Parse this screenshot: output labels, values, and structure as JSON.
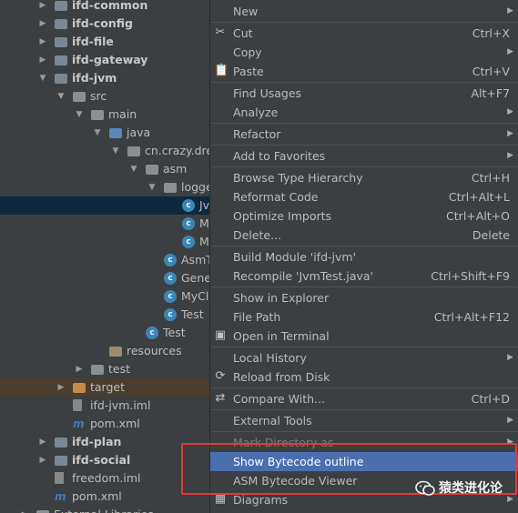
{
  "tree": {
    "items": [
      {
        "label": "ifd-common",
        "bold": true,
        "arrow": "▶",
        "kind": "folder-mod"
      },
      {
        "label": "ifd-config",
        "bold": true,
        "arrow": "▶",
        "kind": "folder-mod"
      },
      {
        "label": "ifd-file",
        "bold": true,
        "arrow": "▶",
        "kind": "folder-mod"
      },
      {
        "label": "ifd-gateway",
        "bold": true,
        "arrow": "▶",
        "kind": "folder-mod"
      },
      {
        "label": "ifd-jvm",
        "bold": true,
        "arrow": "▼",
        "kind": "folder-mod"
      },
      {
        "label": "src",
        "arrow": "▼",
        "kind": "folder"
      },
      {
        "label": "main",
        "arrow": "▼",
        "kind": "folder"
      },
      {
        "label": "java",
        "arrow": "▼",
        "kind": "folder-src"
      },
      {
        "label": "cn.crazy.dreamer",
        "arrow": "▼",
        "kind": "folder-pkg"
      },
      {
        "label": "asm",
        "arrow": "▼",
        "kind": "folder-pkg"
      },
      {
        "label": "logger",
        "arrow": "▼",
        "kind": "folder-pkg"
      },
      {
        "label": "JvmTest",
        "kind": "class",
        "selected": true
      },
      {
        "label": "MyLogg",
        "kind": "class"
      },
      {
        "label": "MyTime",
        "kind": "class"
      },
      {
        "label": "AsmTest",
        "kind": "class"
      },
      {
        "label": "Generator",
        "kind": "class"
      },
      {
        "label": "MyClassVis",
        "kind": "class"
      },
      {
        "label": "Test",
        "kind": "class"
      },
      {
        "label": "Test",
        "kind": "class"
      },
      {
        "label": "resources",
        "kind": "folder-res"
      },
      {
        "label": "test",
        "arrow": "▶",
        "kind": "folder"
      },
      {
        "label": "target",
        "arrow": "▶",
        "kind": "folder-excl",
        "excluded": true
      },
      {
        "label": "ifd-jvm.iml",
        "kind": "iml"
      },
      {
        "label": "pom.xml",
        "kind": "maven"
      },
      {
        "label": "ifd-plan",
        "bold": true,
        "arrow": "▶",
        "kind": "folder-mod"
      },
      {
        "label": "ifd-social",
        "bold": true,
        "arrow": "▶",
        "kind": "folder-mod"
      },
      {
        "label": "freedom.iml",
        "kind": "iml"
      },
      {
        "label": "pom.xml",
        "kind": "maven"
      },
      {
        "label": "External Libraries",
        "arrow": "▶",
        "kind": "folder"
      }
    ]
  },
  "menu": {
    "items": [
      {
        "label": "New",
        "submenu": true,
        "name": "menu-new"
      },
      {
        "sep": true
      },
      {
        "label": "Cut",
        "shortcut": "Ctrl+X",
        "icon": "scissors-icon",
        "glyph": "✂",
        "name": "menu-cut"
      },
      {
        "label": "Copy",
        "submenu": true,
        "name": "menu-copy"
      },
      {
        "label": "Paste",
        "shortcut": "Ctrl+V",
        "icon": "clipboard-icon",
        "glyph": "📋",
        "name": "menu-paste"
      },
      {
        "sep": true
      },
      {
        "label": "Find Usages",
        "shortcut": "Alt+F7",
        "name": "menu-find-usages"
      },
      {
        "label": "Analyze",
        "submenu": true,
        "name": "menu-analyze"
      },
      {
        "sep": true
      },
      {
        "label": "Refactor",
        "submenu": true,
        "name": "menu-refactor"
      },
      {
        "sep": true
      },
      {
        "label": "Add to Favorites",
        "submenu": true,
        "name": "menu-add-to-favorites"
      },
      {
        "sep": true
      },
      {
        "label": "Browse Type Hierarchy",
        "shortcut": "Ctrl+H",
        "name": "menu-browse-type-hierarchy"
      },
      {
        "label": "Reformat Code",
        "shortcut": "Ctrl+Alt+L",
        "name": "menu-reformat-code"
      },
      {
        "label": "Optimize Imports",
        "shortcut": "Ctrl+Alt+O",
        "name": "menu-optimize-imports"
      },
      {
        "label": "Delete...",
        "shortcut": "Delete",
        "name": "menu-delete"
      },
      {
        "sep": true
      },
      {
        "label": "Build Module 'ifd-jvm'",
        "name": "menu-build-module"
      },
      {
        "label": "Recompile 'JvmTest.java'",
        "shortcut": "Ctrl+Shift+F9",
        "name": "menu-recompile"
      },
      {
        "sep": true
      },
      {
        "label": "Show in Explorer",
        "name": "menu-show-in-explorer"
      },
      {
        "label": "File Path",
        "shortcut": "Ctrl+Alt+F12",
        "name": "menu-file-path"
      },
      {
        "label": "Open in Terminal",
        "icon": "terminal-icon",
        "glyph": "▣",
        "name": "menu-open-in-terminal"
      },
      {
        "sep": true
      },
      {
        "label": "Local History",
        "submenu": true,
        "name": "menu-local-history"
      },
      {
        "label": "Reload from Disk",
        "icon": "reload-icon",
        "glyph": "⟳",
        "name": "menu-reload-from-disk"
      },
      {
        "sep": true
      },
      {
        "label": "Compare With...",
        "shortcut": "Ctrl+D",
        "icon": "compare-icon",
        "glyph": "⇄",
        "name": "menu-compare-with"
      },
      {
        "sep": true
      },
      {
        "label": "External Tools",
        "submenu": true,
        "name": "menu-external-tools"
      },
      {
        "sep": true
      },
      {
        "label": "Mark Directory as",
        "disabled": true,
        "submenu": true,
        "name": "menu-mark-directory-as"
      },
      {
        "label": "Show Bytecode outline",
        "highlighted": true,
        "name": "menu-show-bytecode-outline"
      },
      {
        "label": "ASM Bytecode Viewer",
        "name": "menu-asm-bytecode-viewer"
      },
      {
        "label": "Diagrams",
        "submenu": true,
        "icon": "diagram-icon",
        "glyph": "▦",
        "name": "menu-diagrams"
      }
    ]
  },
  "watermark": {
    "text": "猿类进化论"
  },
  "colors": {
    "highlight": "#4b6eaf",
    "annotation_box": "#e53935",
    "selection": "#0d293e"
  }
}
